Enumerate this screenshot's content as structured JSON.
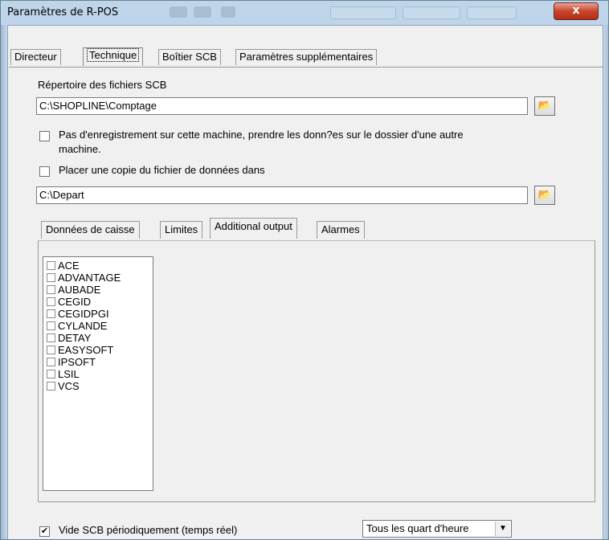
{
  "window": {
    "title": "Paramètres de R-POS",
    "close_glyph": "x"
  },
  "tabs": [
    {
      "label": "Directeur"
    },
    {
      "label": "Technique"
    },
    {
      "label": "Boîtier SCB"
    },
    {
      "label": "Paramètres supplémentaires"
    }
  ],
  "technique": {
    "scb_dir_label": "Répertoire des fichiers SCB",
    "scb_dir_value": "C:\\SHOPLINE\\Comptage",
    "no_record_label_line1": "Pas d'enregistrement sur cette machine, prendre les donn?es sur le dossier d'une autre",
    "no_record_label_line2": "machine.",
    "no_record_checked": false,
    "copy_label": "Placer une copie du fichier de données dans",
    "copy_checked": false,
    "copy_dir_value": "C:\\Depart"
  },
  "subtabs": [
    {
      "label": "Données de caisse"
    },
    {
      "label": "Limites"
    },
    {
      "label": "Additional output"
    },
    {
      "label": "Alarmes"
    }
  ],
  "additional_output": {
    "items": [
      {
        "label": "ACE",
        "checked": false
      },
      {
        "label": "ADVANTAGE",
        "checked": false
      },
      {
        "label": "AUBADE",
        "checked": false
      },
      {
        "label": "CEGID",
        "checked": false
      },
      {
        "label": "CEGIDPGI",
        "checked": false
      },
      {
        "label": "CYLANDE",
        "checked": false
      },
      {
        "label": "DETAY",
        "checked": false
      },
      {
        "label": "EASYSOFT",
        "checked": false
      },
      {
        "label": "IPSOFT",
        "checked": false
      },
      {
        "label": "LSIL",
        "checked": false
      },
      {
        "label": "VCS",
        "checked": false
      }
    ]
  },
  "footer": {
    "empty_scb_label": "Vide SCB périodiquement (temps réel)",
    "empty_scb_checked": true,
    "check_glyph": "✔",
    "period_selected": "Tous les quart d'heure",
    "dropdown_glyph": "▼"
  },
  "icons": {
    "folder_icon_glyph": "📂"
  }
}
